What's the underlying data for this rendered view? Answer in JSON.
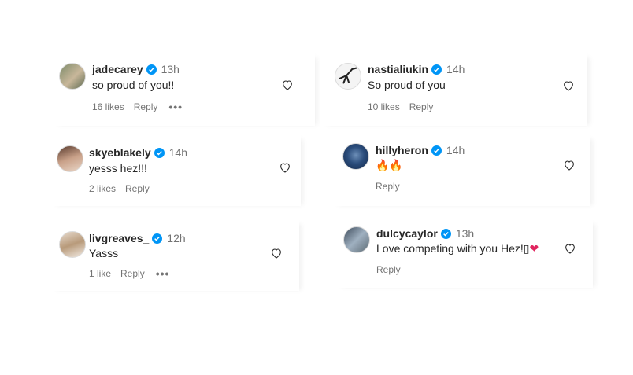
{
  "comments": [
    {
      "username": "jadecarey",
      "time": "13h",
      "text": "so proud of you!!",
      "likes": "16 likes",
      "reply": "Reply",
      "more": "•••"
    },
    {
      "username": "nastialiukin",
      "time": "14h",
      "text": "So proud of you",
      "likes": "10 likes",
      "reply": "Reply"
    },
    {
      "username": "skyeblakely",
      "time": "14h",
      "text": "yesss hez!!!",
      "likes": "2 likes",
      "reply": "Reply"
    },
    {
      "username": "hillyheron",
      "time": "14h",
      "text": "🔥🔥",
      "reply": "Reply"
    },
    {
      "username": "livgreaves_",
      "time": "12h",
      "text": "Yasss",
      "likes": "1 like",
      "reply": "Reply",
      "more": "•••"
    },
    {
      "username": "dulcycaylor",
      "time": "13h",
      "text": "Love competing with you Hez!▯",
      "text_emoji": "❤",
      "reply": "Reply"
    }
  ],
  "colors": {
    "verified": "#0095f6",
    "heart_outline": "#262626",
    "red_heart": "#e0245e",
    "meta": "#737373"
  },
  "icons": {
    "verified": "verified-badge-icon",
    "like": "heart-outline-icon",
    "more": "more-options-icon"
  }
}
